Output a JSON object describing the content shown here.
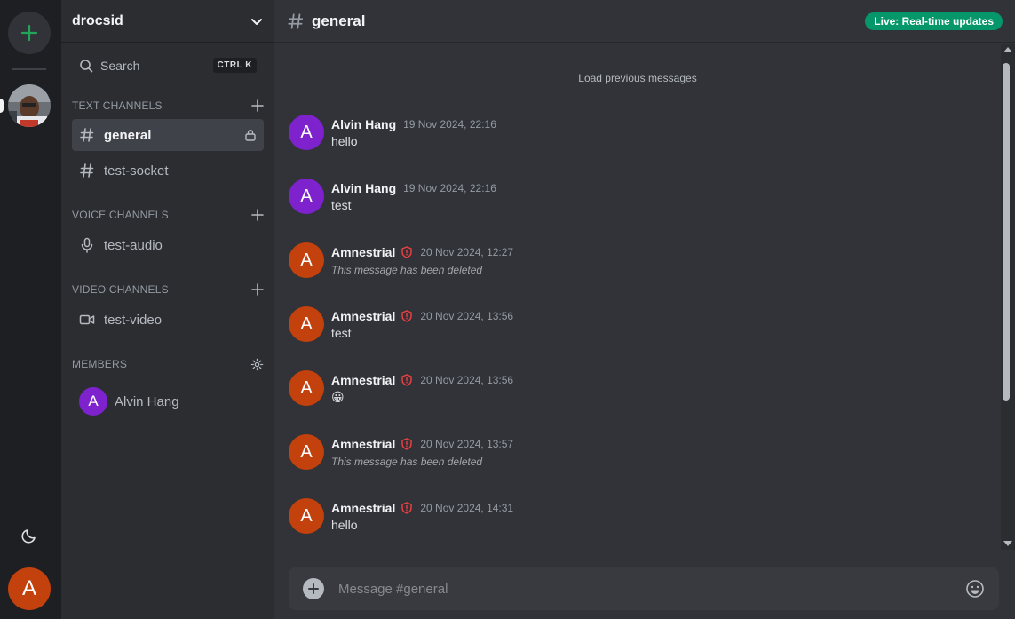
{
  "server": {
    "name": "drocsid"
  },
  "search": {
    "label": "Search",
    "shortcut": "CTRL K"
  },
  "sections": {
    "text": {
      "label": "TEXT CHANNELS"
    },
    "voice": {
      "label": "VOICE CHANNELS"
    },
    "video": {
      "label": "VIDEO CHANNELS"
    },
    "members": {
      "label": "MEMBERS"
    }
  },
  "text_channels": [
    {
      "name": "general",
      "active": true,
      "locked": true
    },
    {
      "name": "test-socket",
      "active": false
    }
  ],
  "voice_channels": [
    {
      "name": "test-audio"
    }
  ],
  "video_channels": [
    {
      "name": "test-video"
    }
  ],
  "members": [
    {
      "name": "Alvin Hang",
      "initial": "A",
      "color": "#7e22ce"
    }
  ],
  "header": {
    "channel": "general",
    "live_badge": "Live: Real-time updates"
  },
  "chat": {
    "load_previous": "Load previous messages",
    "messages": [
      {
        "author": "Alvin Hang",
        "initial": "A",
        "avatar_color": "#7e22ce",
        "moderator": false,
        "timestamp": "19 Nov 2024, 22:16",
        "body": "hello",
        "deleted": false
      },
      {
        "author": "Alvin Hang",
        "initial": "A",
        "avatar_color": "#7e22ce",
        "moderator": false,
        "timestamp": "19 Nov 2024, 22:16",
        "body": "test",
        "deleted": false
      },
      {
        "author": "Amnestrial",
        "initial": "A",
        "avatar_color": "#c2410c",
        "moderator": true,
        "timestamp": "20 Nov 2024, 12:27",
        "body": "This message has been deleted",
        "deleted": true
      },
      {
        "author": "Amnestrial",
        "initial": "A",
        "avatar_color": "#c2410c",
        "moderator": true,
        "timestamp": "20 Nov 2024, 13:56",
        "body": "test",
        "deleted": false
      },
      {
        "author": "Amnestrial",
        "initial": "A",
        "avatar_color": "#c2410c",
        "moderator": true,
        "timestamp": "20 Nov 2024, 13:56",
        "body": "😀",
        "deleted": false
      },
      {
        "author": "Amnestrial",
        "initial": "A",
        "avatar_color": "#c2410c",
        "moderator": true,
        "timestamp": "20 Nov 2024, 13:57",
        "body": "This message has been deleted",
        "deleted": true
      },
      {
        "author": "Amnestrial",
        "initial": "A",
        "avatar_color": "#c2410c",
        "moderator": true,
        "timestamp": "20 Nov 2024, 14:31",
        "body": "hello",
        "deleted": false
      }
    ]
  },
  "composer": {
    "placeholder": "Message #general"
  },
  "current_user": {
    "initial": "A",
    "color": "#c2410c"
  },
  "colors": {
    "accent_green": "#23a559",
    "live_green": "#059669",
    "moderator_red": "#f23f42"
  },
  "icons": {
    "add_server": "plus-icon",
    "theme": "moon-icon",
    "server_header": "chevron-down-icon",
    "search": "search-icon",
    "text_channel": "hash-icon",
    "lock": "lock-icon",
    "voice": "mic-icon",
    "video": "video-icon",
    "members_settings": "gear-icon",
    "moderator": "shield-alert-icon",
    "composer_add": "plus-circle-icon",
    "emoji": "smile-icon"
  }
}
